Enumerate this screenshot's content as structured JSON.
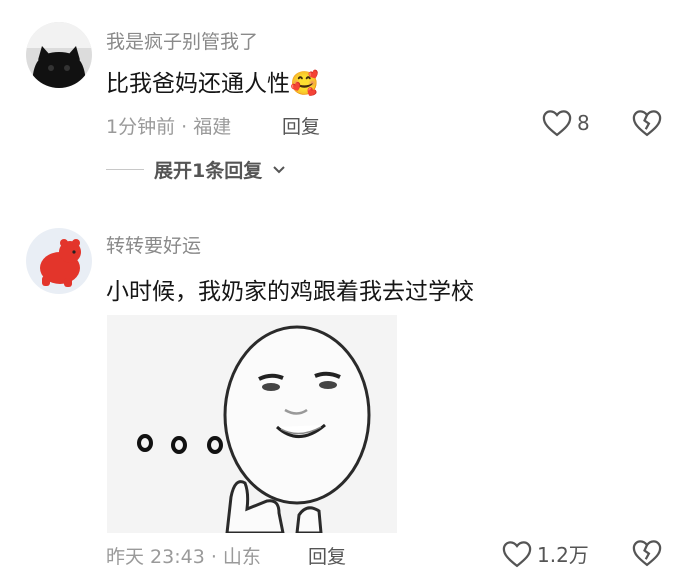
{
  "comments": [
    {
      "username": "我是疯子别管我了",
      "text": "比我爸妈还通人性",
      "emoji": "🥰",
      "meta": "1分钟前 · 福建",
      "reply_label": "回复",
      "likes": "8",
      "expand_label": "展开1条回复"
    },
    {
      "username": "转转要好运",
      "text": "小时候，我奶家的鸡跟着我去过学校",
      "meta": "昨天 23:43 · 山东",
      "reply_label": "回复",
      "likes": "1.2万"
    }
  ],
  "colors": {
    "username": "#8a8a8a",
    "meta": "#9a9a9a",
    "text": "#161616",
    "avatar2_bg": "#e9eef5",
    "avatar2_bear": "#e3352b"
  }
}
